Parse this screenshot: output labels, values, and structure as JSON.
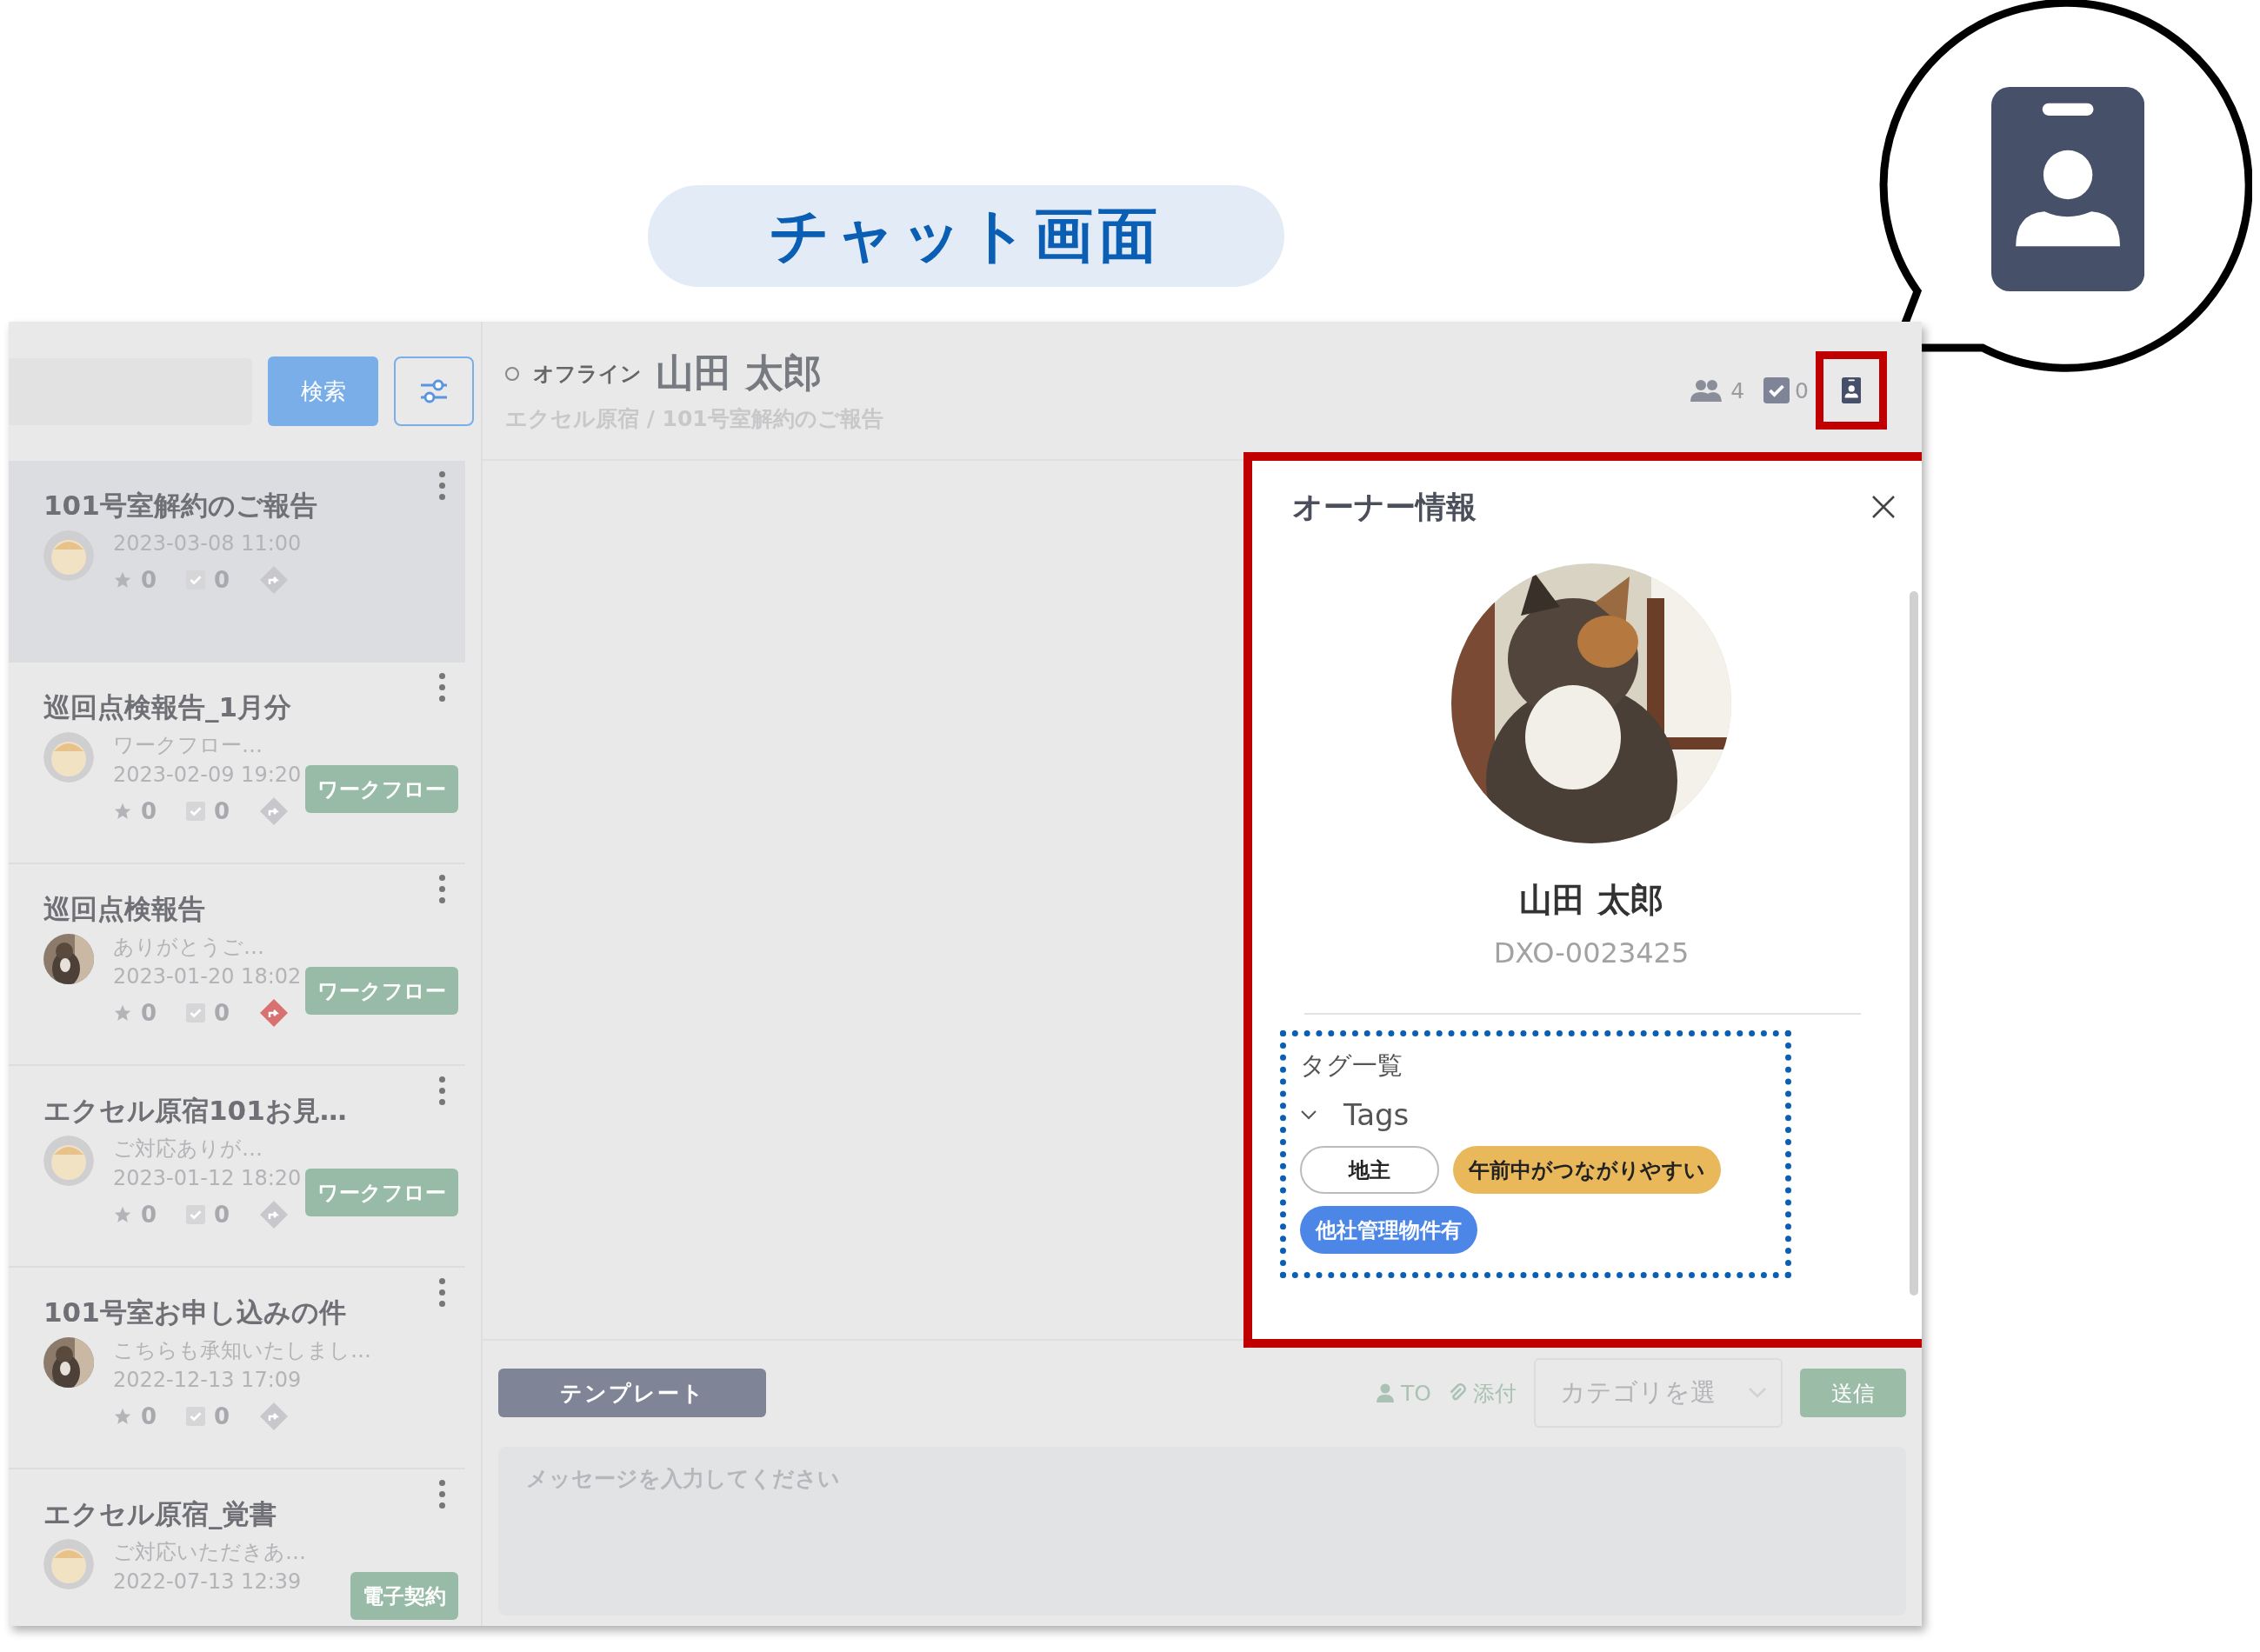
{
  "heading": "チャット画面",
  "sidebar": {
    "search_button": "検索",
    "threads": [
      {
        "title": "101号室解約のご報告",
        "avatar": {
          "kind": "illustration"
        },
        "date": "2023-03-08 11:00",
        "stars": "0",
        "tasks": "0",
        "flagged": false,
        "selected": true
      },
      {
        "title": "巡回点検報告_1月分",
        "avatar": {
          "kind": "illustration"
        },
        "preview": "ワークフロー…",
        "date": "2023-02-09 19:20",
        "stars": "0",
        "tasks": "0",
        "flagged": false,
        "tag": "ワークフロー",
        "selected": false
      },
      {
        "title": "巡回点検報告",
        "preview": "ありがとうご…",
        "date": "2023-01-20 18:02",
        "stars": "0",
        "tasks": "0",
        "flagged": true,
        "tag": "ワークフロー",
        "selected": false
      },
      {
        "title": "エクセル原宿101お見…",
        "avatar": {
          "kind": "illustration"
        },
        "preview": "ご対応ありが…",
        "date": "2023-01-12 18:20",
        "stars": "0",
        "tasks": "0",
        "flagged": false,
        "tag": "ワークフロー",
        "selected": false
      },
      {
        "title": "101号室お申し込みの件",
        "preview": "こちらも承知いたしまし…",
        "date": "2022-12-13 17:09",
        "stars": "0",
        "tasks": "0",
        "flagged": false,
        "selected": false
      },
      {
        "title": "エクセル原宿_覚書",
        "avatar": {
          "kind": "illustration"
        },
        "preview": "ご対応いただきあ…",
        "date": "2022-07-13 12:39",
        "tag": "電子契約",
        "selected": false
      }
    ]
  },
  "header": {
    "status": "オフライン",
    "name": "山田 太郎",
    "breadcrumb": "エクセル原宿 / 101号室解約のご報告",
    "members": "4",
    "tasks": "0"
  },
  "owner_panel": {
    "title": "オーナー情報",
    "name": "山田 太郎",
    "id": "DXO-0023425",
    "section": "タグ一覧",
    "group": {
      "label": "Tags",
      "expanded": true
    },
    "tags": [
      {
        "label": "地主",
        "color": "#ffffff"
      },
      {
        "label": "午前中がつながりやすい",
        "color": "#e8b85a"
      },
      {
        "label": "他社管理物件有",
        "color": "#4c86e6"
      }
    ]
  },
  "composer": {
    "template_button": "テンプレート",
    "to": "TO",
    "attach": "添付",
    "category": "カテゴリを選",
    "send": "送信",
    "placeholder": "メッセージを入力してください"
  }
}
